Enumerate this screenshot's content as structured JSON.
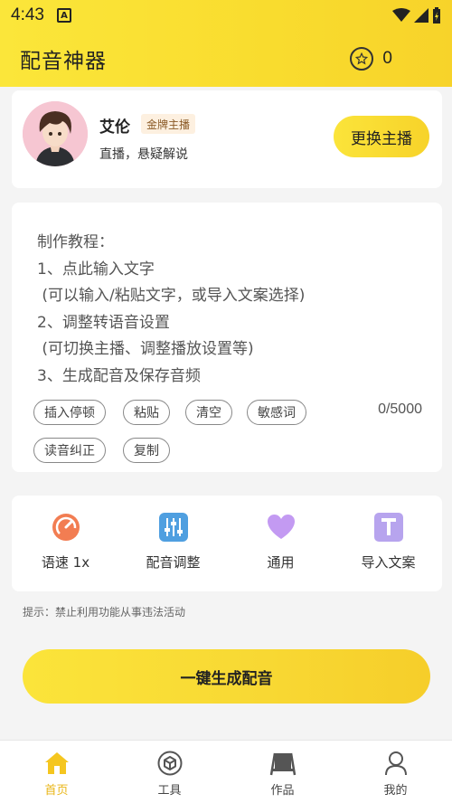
{
  "status": {
    "time": "4:43",
    "notif_letter": "A"
  },
  "header": {
    "title": "配音神器",
    "coin_count": "0"
  },
  "anchor": {
    "name": "艾伦",
    "badge": "金牌主播",
    "tags": "直播，悬疑解说",
    "change_label": "更换主播"
  },
  "editor": {
    "tutorial": [
      "制作教程：",
      "1、点此输入文字",
      " (可以输入/粘贴文字，或导入文案选择)",
      "2、调整转语音设置",
      " (可切换主播、调整播放设置等)",
      "3、生成配音及保存音频"
    ],
    "chips": [
      "插入停顿",
      "粘贴",
      "清空",
      "敏感词",
      "读音纠正",
      "复制"
    ],
    "counter": "0/5000"
  },
  "tools": [
    {
      "label": "语速 1x",
      "icon": "speedometer-icon"
    },
    {
      "label": "配音调整",
      "icon": "equalizer-icon"
    },
    {
      "label": "通用",
      "icon": "heart-icon"
    },
    {
      "label": "导入文案",
      "icon": "text-import-icon"
    }
  ],
  "hint": "提示：禁止利用功能从事违法活动",
  "generate_label": "一键生成配音",
  "tabs": [
    {
      "label": "首页",
      "icon": "home-icon",
      "active": true
    },
    {
      "label": "工具",
      "icon": "cube-icon",
      "active": false
    },
    {
      "label": "作品",
      "icon": "works-icon",
      "active": false
    },
    {
      "label": "我的",
      "icon": "user-icon",
      "active": false
    }
  ],
  "colors": {
    "accent": "#f9dc2e",
    "active_tab": "#e9b617"
  }
}
